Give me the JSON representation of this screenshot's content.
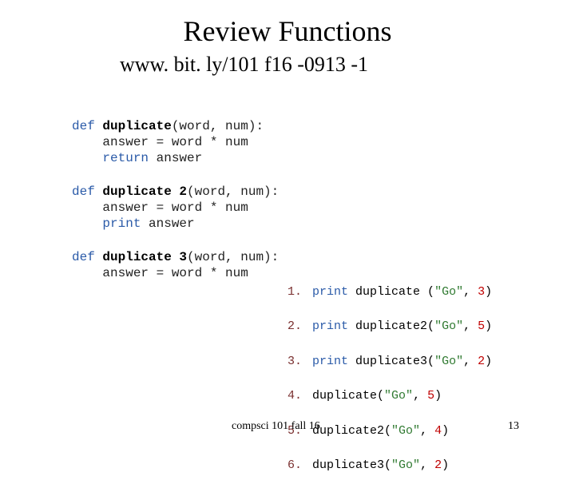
{
  "title": "Review Functions",
  "url": "www. bit. ly/101 f16 -0913 -1",
  "defs": {
    "d1": {
      "kw": "def ",
      "name": "duplicate",
      "params": "(word, num):",
      "l2": "    answer = word * num",
      "ret_kw": "    return ",
      "ret_val": "answer"
    },
    "d2": {
      "kw": "def ",
      "name": "duplicate 2",
      "params": "(word, num):",
      "l2": "    answer = word * num",
      "pr_kw": "    print ",
      "pr_val": "answer"
    },
    "d3": {
      "kw": "def ",
      "name": "duplicate 3",
      "params": "(word, num):",
      "l2": "    answer = word * num"
    }
  },
  "calls": {
    "c1": {
      "n": "1.",
      "pr": "print ",
      "fn": "duplicate ",
      "open": "(",
      "str": "\"Go\"",
      "sep": ", ",
      "num": "3",
      "close": ")"
    },
    "c2": {
      "n": "2.",
      "pr": "print ",
      "fn": "duplicate2",
      "open": "(",
      "str": "\"Go\"",
      "sep": ", ",
      "num": "5",
      "close": ")"
    },
    "c3": {
      "n": "3.",
      "pr": "print ",
      "fn": "duplicate3",
      "open": "(",
      "str": "\"Go\"",
      "sep": ", ",
      "num": "2",
      "close": ")"
    },
    "c4": {
      "n": "4.",
      "pr": "",
      "fn": "duplicate",
      "open": "(",
      "str": "\"Go\"",
      "sep": ", ",
      "num": "5",
      "close": ")"
    },
    "c5": {
      "n": "5.",
      "pr": "",
      "fn": "duplicate2",
      "open": "(",
      "str": "\"Go\"",
      "sep": ", ",
      "num": "4",
      "close": ")"
    },
    "c6": {
      "n": "6.",
      "pr": "",
      "fn": "duplicate3",
      "open": "(",
      "str": "\"Go\"",
      "sep": ", ",
      "num": "2",
      "close": ")"
    }
  },
  "footer": {
    "left": "compsci 101 fall 16",
    "right": "13"
  }
}
